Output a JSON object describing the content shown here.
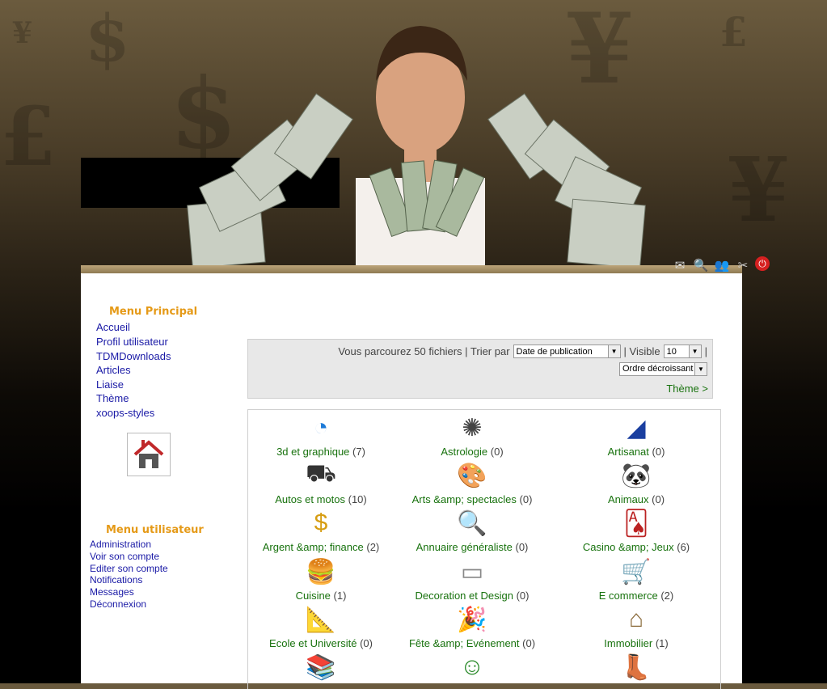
{
  "background_symbols": [
    "$",
    "¥",
    "£",
    "¥",
    "$",
    "£",
    "¥"
  ],
  "toolbar": {
    "icons": [
      "mail-icon",
      "search-icon",
      "users-icon",
      "tools-icon",
      "power-icon"
    ]
  },
  "main_menu": {
    "title": "Menu Principal",
    "items": [
      "Accueil",
      "Profil utilisateur",
      "TDMDownloads",
      "Articles",
      "Liaise",
      "Thème",
      "xoops-styles"
    ]
  },
  "user_menu": {
    "title": "Menu utilisateur",
    "items": [
      "Administration",
      "Voir son compte",
      "Editer son compte",
      "Notifications",
      "Messages",
      "Déconnexion"
    ]
  },
  "filter": {
    "browsing_text": "Vous parcourez 50 fichiers | Trier par",
    "sort_value": "Date de publication",
    "visible_label": "| Visible",
    "visible_value": "10",
    "trailing": "|",
    "order_value": "Ordre décroissant",
    "theme_link": "Thème >"
  },
  "categories": [
    {
      "label": "3d et graphique",
      "count": "(7)",
      "icon": "pie-chart-icon"
    },
    {
      "label": "Astrologie",
      "count": "(0)",
      "icon": "crab-icon"
    },
    {
      "label": "Artisanat",
      "count": "(0)",
      "icon": "craft-icon"
    },
    {
      "label": "Autos et motos",
      "count": "(10)",
      "icon": "motorcycle-icon"
    },
    {
      "label": "Arts &amp; spectacles",
      "count": "(0)",
      "icon": "palette-icon"
    },
    {
      "label": "Animaux",
      "count": "(0)",
      "icon": "panda-icon"
    },
    {
      "label": "Argent &amp; finance",
      "count": "(2)",
      "icon": "money-icon"
    },
    {
      "label": "Annuaire généraliste",
      "count": "(0)",
      "icon": "magnifier-icon"
    },
    {
      "label": "Casino &amp; Jeux",
      "count": "(6)",
      "icon": "cards-icon"
    },
    {
      "label": "Cuisine",
      "count": "(1)",
      "icon": "burger-icon"
    },
    {
      "label": "Decoration et Design",
      "count": "(0)",
      "icon": "sofa-icon"
    },
    {
      "label": "E commerce",
      "count": "(2)",
      "icon": "cart-icon"
    },
    {
      "label": "Ecole et Université",
      "count": "(0)",
      "icon": "ruler-icon"
    },
    {
      "label": "Fête &amp; Evénement",
      "count": "(0)",
      "icon": "party-icon"
    },
    {
      "label": "Immobilier",
      "count": "(1)",
      "icon": "house-icon"
    },
    {
      "label": "",
      "count": "",
      "icon": "books-icon"
    },
    {
      "label": "",
      "count": "",
      "icon": "kid-icon"
    },
    {
      "label": "",
      "count": "",
      "icon": "boot-icon"
    }
  ]
}
